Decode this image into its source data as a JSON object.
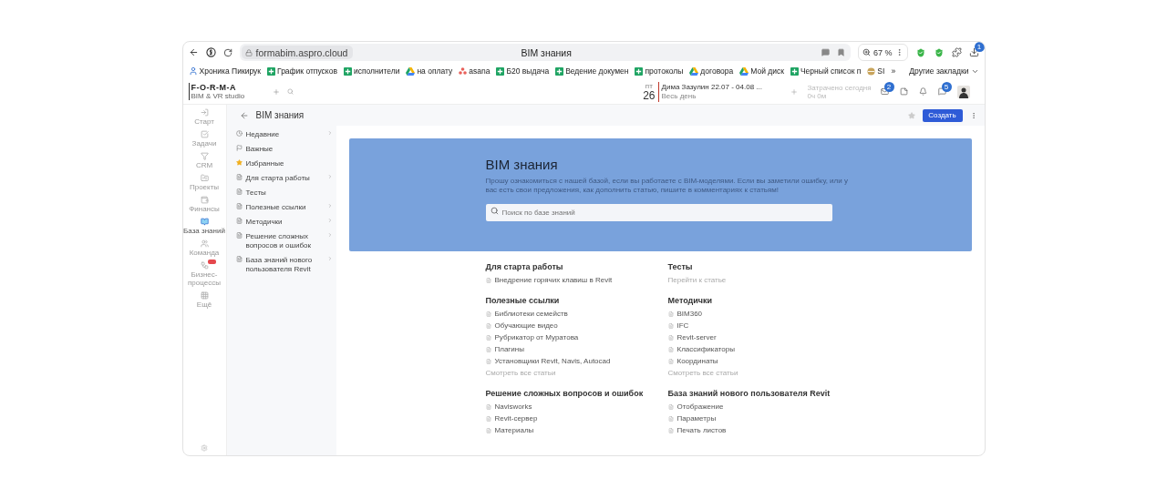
{
  "browser": {
    "url": "formabim.aspro.cloud",
    "tab_title": "BIM знания",
    "zoom": "67 %",
    "download_badge": "1",
    "bookmarks": [
      {
        "label": "Хроника Пикирук",
        "kind": "person"
      },
      {
        "label": "График отпусков",
        "kind": "sheet"
      },
      {
        "label": "исполнители",
        "kind": "sheet"
      },
      {
        "label": "на оплату",
        "kind": "drive"
      },
      {
        "label": "asana",
        "kind": "asana"
      },
      {
        "label": "Б20 выдача",
        "kind": "sheet"
      },
      {
        "label": "Ведение докумен",
        "kind": "sheet"
      },
      {
        "label": "протоколы",
        "kind": "sheet"
      },
      {
        "label": "договора",
        "kind": "drive"
      },
      {
        "label": "Мой диск",
        "kind": "drive"
      },
      {
        "label": "Черный список п",
        "kind": "sheet"
      },
      {
        "label": "SI",
        "kind": "other"
      }
    ],
    "overflow": "»",
    "other_bookmarks": "Другие закладки"
  },
  "app_header": {
    "logo": "F-O-R-M-A",
    "logo_sub": "BIM & VR studio",
    "calendar": {
      "weekday": "пт",
      "day": "26",
      "event": "Дима Зазулин 22.07 - 04.08 ...",
      "event_sub": "Весь день"
    },
    "worktime": {
      "label": "Затрачено сегодня",
      "value": "0ч 0м"
    },
    "icons": [
      {
        "kind": "mail",
        "badge": "2"
      },
      {
        "kind": "notes"
      },
      {
        "kind": "bell"
      },
      {
        "kind": "chat",
        "badge": "5"
      }
    ]
  },
  "rail": [
    {
      "label": "Старт",
      "kind": "start",
      "selected": false
    },
    {
      "label": "Задачи",
      "kind": "tasks",
      "selected": false
    },
    {
      "label": "CRM",
      "kind": "crm",
      "selected": false
    },
    {
      "label": "Проекты",
      "kind": "projects",
      "selected": false
    },
    {
      "label": "Финансы",
      "kind": "finance",
      "selected": false
    },
    {
      "label": "База знаний",
      "kind": "knowledge",
      "selected": true
    },
    {
      "label": "Команда",
      "kind": "team",
      "selected": false
    },
    {
      "label": "Бизнес-процессы",
      "kind": "process",
      "selected": false,
      "new_badge": true
    },
    {
      "label": "Ещё",
      "kind": "more",
      "selected": false
    }
  ],
  "page": {
    "title": "BIM знания",
    "create_button": "Создать"
  },
  "nav": [
    {
      "label": "Недавние",
      "kind": "recent",
      "submenu": true
    },
    {
      "label": "Важные",
      "kind": "flag",
      "submenu": false
    },
    {
      "label": "Избранные",
      "kind": "star",
      "submenu": false
    },
    {
      "label": "Для старта работы",
      "kind": "doc",
      "submenu": true
    },
    {
      "label": "Тесты",
      "kind": "doc",
      "submenu": false
    },
    {
      "label": "Полезные ссылки",
      "kind": "doc",
      "submenu": true
    },
    {
      "label": "Методички",
      "kind": "doc",
      "submenu": true
    },
    {
      "label": "Решение сложных вопросов и ошибок",
      "kind": "doc",
      "submenu": true
    },
    {
      "label": "База знаний нового пользователя Revit",
      "kind": "doc",
      "submenu": true
    }
  ],
  "hero": {
    "title": "BIM знания",
    "description": "Прошу ознакомиться с нашей базой, если вы работаете с BIM-моделями. Если вы заметили ошибку, или у вас есть свои предложения, как дополнить статью, пишите в комментариях к статьям!",
    "search_placeholder": "Поиск по базе знаний"
  },
  "sections": [
    {
      "title": "Для старта работы",
      "items": [
        "Внедрение горячих клавиш в Revit"
      ]
    },
    {
      "title": "Тесты",
      "link": "Перейти к статье"
    },
    {
      "title": "Полезные ссылки",
      "items": [
        "Библиотеки семейств",
        "Обучающие видео",
        "Рубрикатор от Муратова",
        "Плагины",
        "Установщики Revit, Navis, Autocad"
      ],
      "link": "Смотреть все статьи"
    },
    {
      "title": "Методички",
      "items": [
        "BIM360",
        "IFC",
        "Revit-server",
        "Классификаторы",
        "Координаты"
      ],
      "link": "Смотреть все статьи"
    },
    {
      "title": "Решение сложных вопросов и ошибок",
      "items": [
        "Navisworks",
        "Revit-сервер",
        "Материалы"
      ]
    },
    {
      "title": "База знаний нового пользователя Revit",
      "items": [
        "Отображение",
        "Параметры",
        "Печать листов"
      ]
    }
  ]
}
